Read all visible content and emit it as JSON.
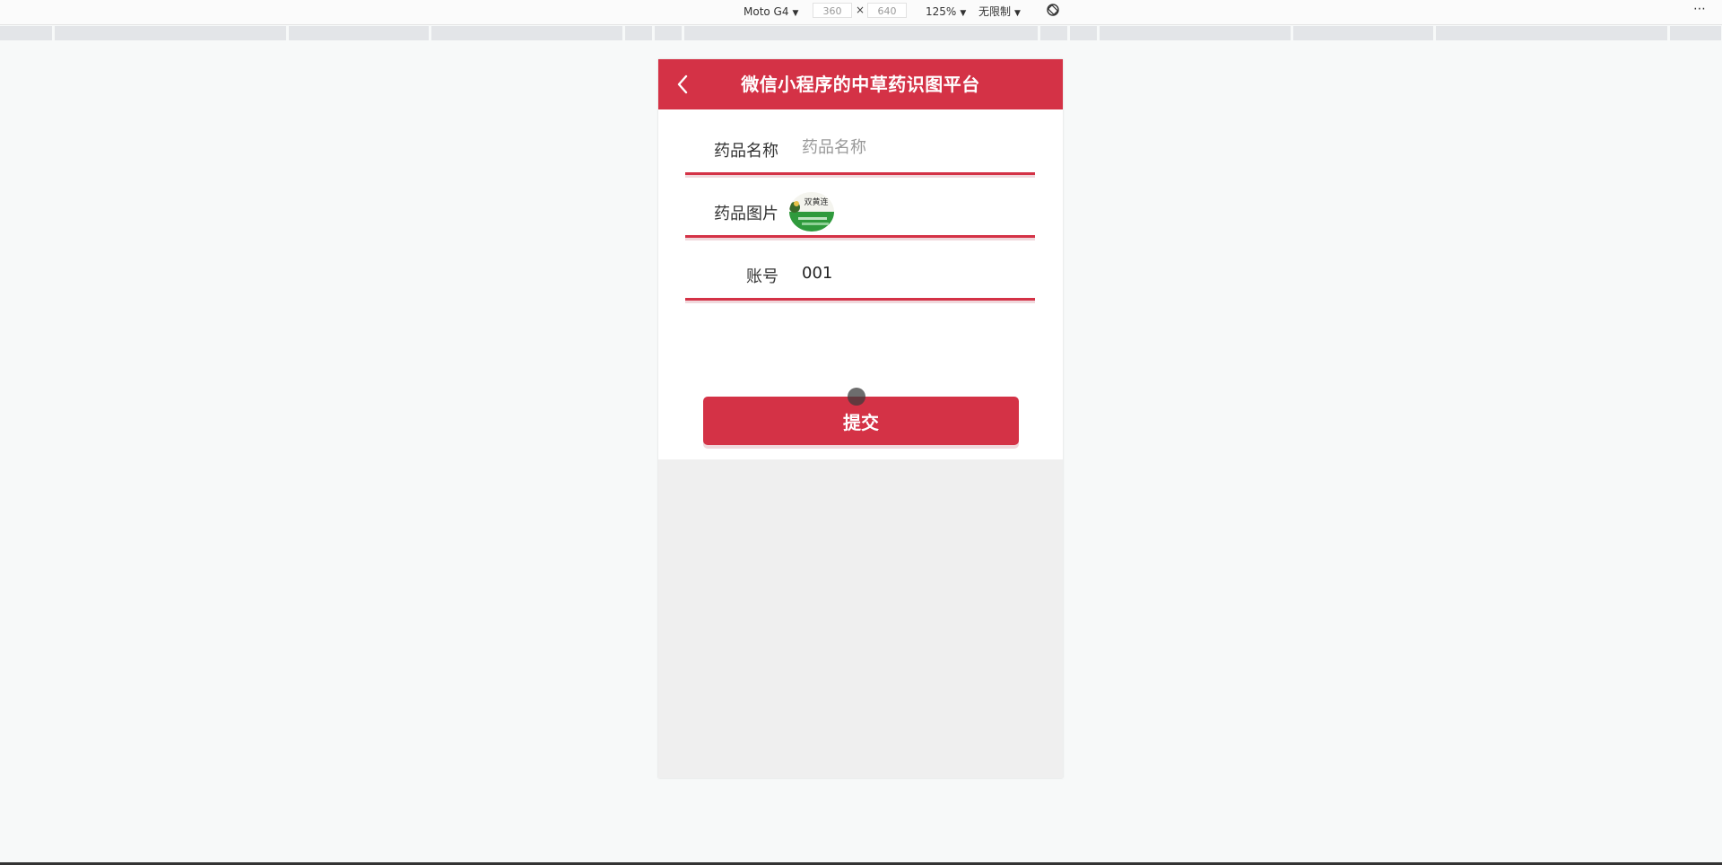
{
  "devtools": {
    "device": "Moto G4",
    "width": "360",
    "height": "640",
    "times": "×",
    "zoom": "125%",
    "throttle": "无限制",
    "more": "⋯"
  },
  "app": {
    "title": "微信小程序的中草药识图平台",
    "colors": {
      "primary": "#d43246"
    }
  },
  "form": {
    "name_label": "药品名称",
    "name_placeholder": "药品名称",
    "name_value": "",
    "image_label": "药品图片",
    "image_text": "双黄连",
    "account_label": "账号",
    "account_value": "001",
    "submit_label": "提交"
  }
}
